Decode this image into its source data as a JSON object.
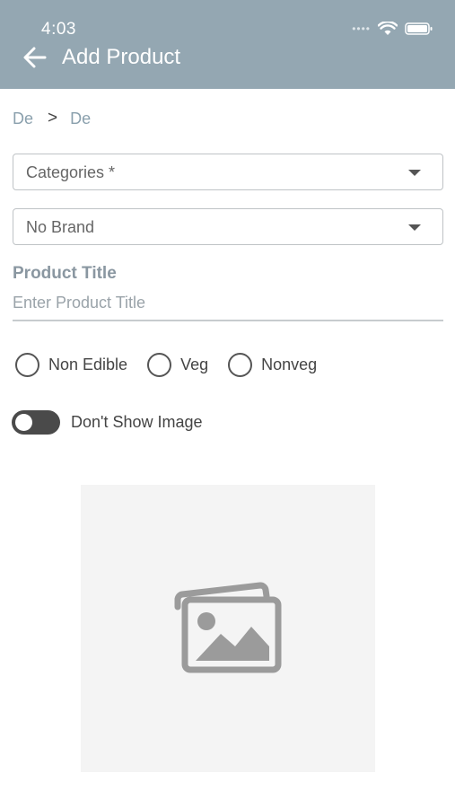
{
  "status_bar": {
    "time": "4:03"
  },
  "app_bar": {
    "title": "Add Product"
  },
  "breadcrumb": {
    "items": [
      "De",
      "De"
    ],
    "separator": ">"
  },
  "category_select": {
    "value": "Categories *"
  },
  "brand_select": {
    "value": "No Brand"
  },
  "product_title": {
    "label": "Product Title",
    "placeholder": "Enter Product Title",
    "value": ""
  },
  "food_type": {
    "options": [
      "Non Edible",
      "Veg",
      "Nonveg"
    ],
    "selected": null
  },
  "image_toggle": {
    "label": "Don't Show Image",
    "enabled": false
  },
  "image_placeholder": {
    "icon": "image-placeholder-icon"
  },
  "colors": {
    "app_bar": "#94a7b2",
    "accent_text": "#8aa0ad",
    "toggle_track": "#4a4a4a"
  }
}
